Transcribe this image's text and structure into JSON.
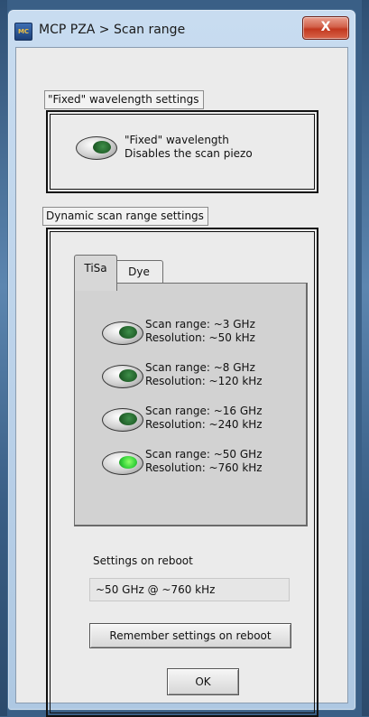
{
  "window": {
    "title": "MCP PZA > Scan range",
    "icon_text": "MC",
    "close_glyph": "X"
  },
  "fixed_group": {
    "label": "\"Fixed\" wavelength settings",
    "line1": "\"Fixed\" wavelength",
    "line2": "Disables the scan piezo"
  },
  "dynamic_group": {
    "label": "Dynamic scan range settings"
  },
  "tabs": [
    {
      "label": "TiSa"
    },
    {
      "label": "Dye"
    }
  ],
  "scan_options": [
    {
      "range": "Scan range: ~3 GHz",
      "resolution": "Resolution: ~50 kHz"
    },
    {
      "range": "Scan range: ~8 GHz",
      "resolution": "Resolution: ~120 kHz"
    },
    {
      "range": "Scan range: ~16 GHz",
      "resolution": "Resolution: ~240 kHz"
    },
    {
      "range": "Scan range: ~50 GHz",
      "resolution": "Resolution: ~760 kHz"
    }
  ],
  "reboot": {
    "label": "Settings on reboot",
    "value": "~50 GHz @ ~760 kHz",
    "button": "Remember settings on reboot"
  },
  "ok_label": "OK"
}
